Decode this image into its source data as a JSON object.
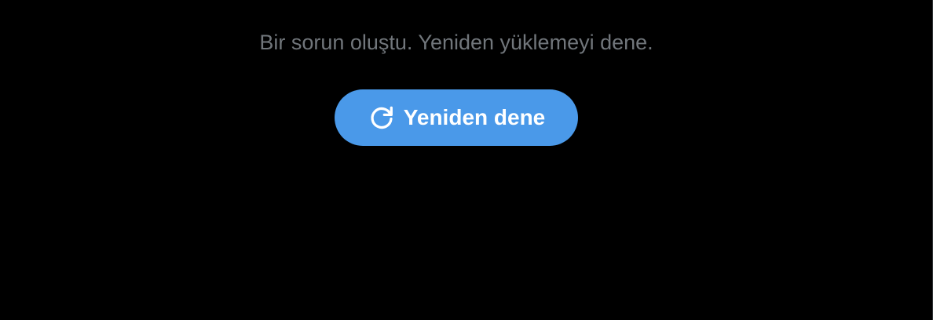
{
  "error": {
    "message": "Bir sorun oluştu. Yeniden yüklemeyi dene."
  },
  "retry_button": {
    "label": "Yeniden dene",
    "icon": "refresh-icon"
  },
  "colors": {
    "background": "#000000",
    "message_text": "#71767b",
    "button_background": "#4a99e9",
    "button_text": "#ffffff",
    "divider": "#2f3336"
  }
}
